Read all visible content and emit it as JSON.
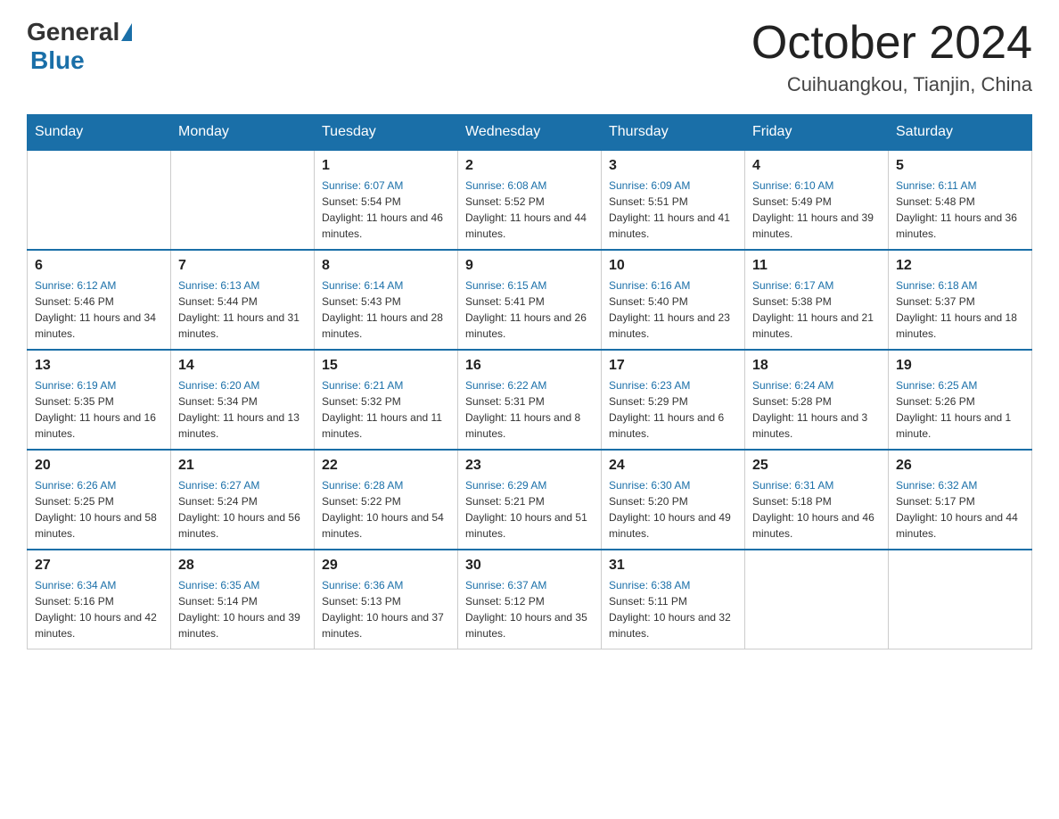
{
  "header": {
    "logo_general": "General",
    "logo_blue": "Blue",
    "month": "October 2024",
    "location": "Cuihuangkou, Tianjin, China"
  },
  "days_of_week": [
    "Sunday",
    "Monday",
    "Tuesday",
    "Wednesday",
    "Thursday",
    "Friday",
    "Saturday"
  ],
  "weeks": [
    [
      {
        "day": "",
        "info": ""
      },
      {
        "day": "",
        "info": ""
      },
      {
        "day": "1",
        "sunrise": "Sunrise: 6:07 AM",
        "sunset": "Sunset: 5:54 PM",
        "daylight": "Daylight: 11 hours and 46 minutes."
      },
      {
        "day": "2",
        "sunrise": "Sunrise: 6:08 AM",
        "sunset": "Sunset: 5:52 PM",
        "daylight": "Daylight: 11 hours and 44 minutes."
      },
      {
        "day": "3",
        "sunrise": "Sunrise: 6:09 AM",
        "sunset": "Sunset: 5:51 PM",
        "daylight": "Daylight: 11 hours and 41 minutes."
      },
      {
        "day": "4",
        "sunrise": "Sunrise: 6:10 AM",
        "sunset": "Sunset: 5:49 PM",
        "daylight": "Daylight: 11 hours and 39 minutes."
      },
      {
        "day": "5",
        "sunrise": "Sunrise: 6:11 AM",
        "sunset": "Sunset: 5:48 PM",
        "daylight": "Daylight: 11 hours and 36 minutes."
      }
    ],
    [
      {
        "day": "6",
        "sunrise": "Sunrise: 6:12 AM",
        "sunset": "Sunset: 5:46 PM",
        "daylight": "Daylight: 11 hours and 34 minutes."
      },
      {
        "day": "7",
        "sunrise": "Sunrise: 6:13 AM",
        "sunset": "Sunset: 5:44 PM",
        "daylight": "Daylight: 11 hours and 31 minutes."
      },
      {
        "day": "8",
        "sunrise": "Sunrise: 6:14 AM",
        "sunset": "Sunset: 5:43 PM",
        "daylight": "Daylight: 11 hours and 28 minutes."
      },
      {
        "day": "9",
        "sunrise": "Sunrise: 6:15 AM",
        "sunset": "Sunset: 5:41 PM",
        "daylight": "Daylight: 11 hours and 26 minutes."
      },
      {
        "day": "10",
        "sunrise": "Sunrise: 6:16 AM",
        "sunset": "Sunset: 5:40 PM",
        "daylight": "Daylight: 11 hours and 23 minutes."
      },
      {
        "day": "11",
        "sunrise": "Sunrise: 6:17 AM",
        "sunset": "Sunset: 5:38 PM",
        "daylight": "Daylight: 11 hours and 21 minutes."
      },
      {
        "day": "12",
        "sunrise": "Sunrise: 6:18 AM",
        "sunset": "Sunset: 5:37 PM",
        "daylight": "Daylight: 11 hours and 18 minutes."
      }
    ],
    [
      {
        "day": "13",
        "sunrise": "Sunrise: 6:19 AM",
        "sunset": "Sunset: 5:35 PM",
        "daylight": "Daylight: 11 hours and 16 minutes."
      },
      {
        "day": "14",
        "sunrise": "Sunrise: 6:20 AM",
        "sunset": "Sunset: 5:34 PM",
        "daylight": "Daylight: 11 hours and 13 minutes."
      },
      {
        "day": "15",
        "sunrise": "Sunrise: 6:21 AM",
        "sunset": "Sunset: 5:32 PM",
        "daylight": "Daylight: 11 hours and 11 minutes."
      },
      {
        "day": "16",
        "sunrise": "Sunrise: 6:22 AM",
        "sunset": "Sunset: 5:31 PM",
        "daylight": "Daylight: 11 hours and 8 minutes."
      },
      {
        "day": "17",
        "sunrise": "Sunrise: 6:23 AM",
        "sunset": "Sunset: 5:29 PM",
        "daylight": "Daylight: 11 hours and 6 minutes."
      },
      {
        "day": "18",
        "sunrise": "Sunrise: 6:24 AM",
        "sunset": "Sunset: 5:28 PM",
        "daylight": "Daylight: 11 hours and 3 minutes."
      },
      {
        "day": "19",
        "sunrise": "Sunrise: 6:25 AM",
        "sunset": "Sunset: 5:26 PM",
        "daylight": "Daylight: 11 hours and 1 minute."
      }
    ],
    [
      {
        "day": "20",
        "sunrise": "Sunrise: 6:26 AM",
        "sunset": "Sunset: 5:25 PM",
        "daylight": "Daylight: 10 hours and 58 minutes."
      },
      {
        "day": "21",
        "sunrise": "Sunrise: 6:27 AM",
        "sunset": "Sunset: 5:24 PM",
        "daylight": "Daylight: 10 hours and 56 minutes."
      },
      {
        "day": "22",
        "sunrise": "Sunrise: 6:28 AM",
        "sunset": "Sunset: 5:22 PM",
        "daylight": "Daylight: 10 hours and 54 minutes."
      },
      {
        "day": "23",
        "sunrise": "Sunrise: 6:29 AM",
        "sunset": "Sunset: 5:21 PM",
        "daylight": "Daylight: 10 hours and 51 minutes."
      },
      {
        "day": "24",
        "sunrise": "Sunrise: 6:30 AM",
        "sunset": "Sunset: 5:20 PM",
        "daylight": "Daylight: 10 hours and 49 minutes."
      },
      {
        "day": "25",
        "sunrise": "Sunrise: 6:31 AM",
        "sunset": "Sunset: 5:18 PM",
        "daylight": "Daylight: 10 hours and 46 minutes."
      },
      {
        "day": "26",
        "sunrise": "Sunrise: 6:32 AM",
        "sunset": "Sunset: 5:17 PM",
        "daylight": "Daylight: 10 hours and 44 minutes."
      }
    ],
    [
      {
        "day": "27",
        "sunrise": "Sunrise: 6:34 AM",
        "sunset": "Sunset: 5:16 PM",
        "daylight": "Daylight: 10 hours and 42 minutes."
      },
      {
        "day": "28",
        "sunrise": "Sunrise: 6:35 AM",
        "sunset": "Sunset: 5:14 PM",
        "daylight": "Daylight: 10 hours and 39 minutes."
      },
      {
        "day": "29",
        "sunrise": "Sunrise: 6:36 AM",
        "sunset": "Sunset: 5:13 PM",
        "daylight": "Daylight: 10 hours and 37 minutes."
      },
      {
        "day": "30",
        "sunrise": "Sunrise: 6:37 AM",
        "sunset": "Sunset: 5:12 PM",
        "daylight": "Daylight: 10 hours and 35 minutes."
      },
      {
        "day": "31",
        "sunrise": "Sunrise: 6:38 AM",
        "sunset": "Sunset: 5:11 PM",
        "daylight": "Daylight: 10 hours and 32 minutes."
      },
      {
        "day": "",
        "info": ""
      },
      {
        "day": "",
        "info": ""
      }
    ]
  ]
}
